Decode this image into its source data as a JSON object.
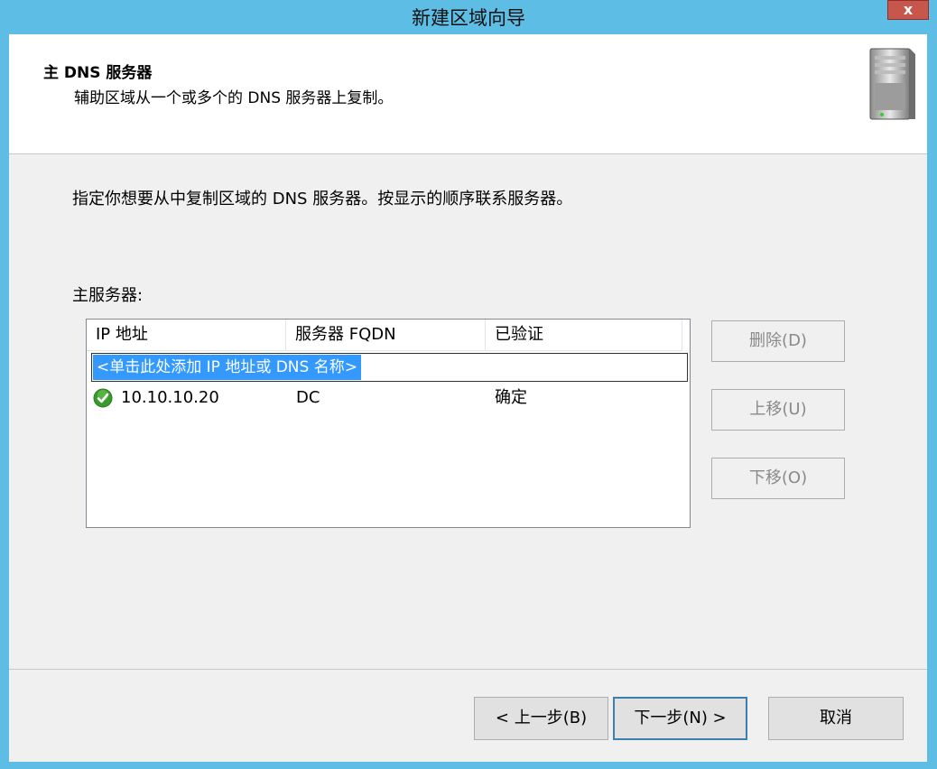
{
  "window": {
    "title": "新建区域向导",
    "close_label": "x"
  },
  "header": {
    "title": "主 DNS 服务器",
    "subtitle": "辅助区域从一个或多个的 DNS 服务器上复制。",
    "icon": "server-icon"
  },
  "content": {
    "instruction": "指定你想要从中复制区域的 DNS 服务器。按显示的顺序联系服务器。",
    "list_label": "主服务器:",
    "columns": [
      "IP 地址",
      "服务器 FQDN",
      "已验证"
    ],
    "add_placeholder": "<单击此处添加 IP 地址或 DNS 名称>",
    "rows": [
      {
        "ip": "10.10.10.20",
        "fqdn": "DC",
        "verified": "确定",
        "status_icon": "check-circle-icon"
      }
    ]
  },
  "side_buttons": {
    "delete": "删除(D)",
    "up": "上移(U)",
    "down": "下移(O)"
  },
  "footer": {
    "back": "< 上一步(B)",
    "next": "下一步(N) >",
    "cancel": "取消"
  },
  "colors": {
    "frame": "#5ebde5",
    "selection": "#3399ff",
    "check": "#3a9b2c"
  }
}
